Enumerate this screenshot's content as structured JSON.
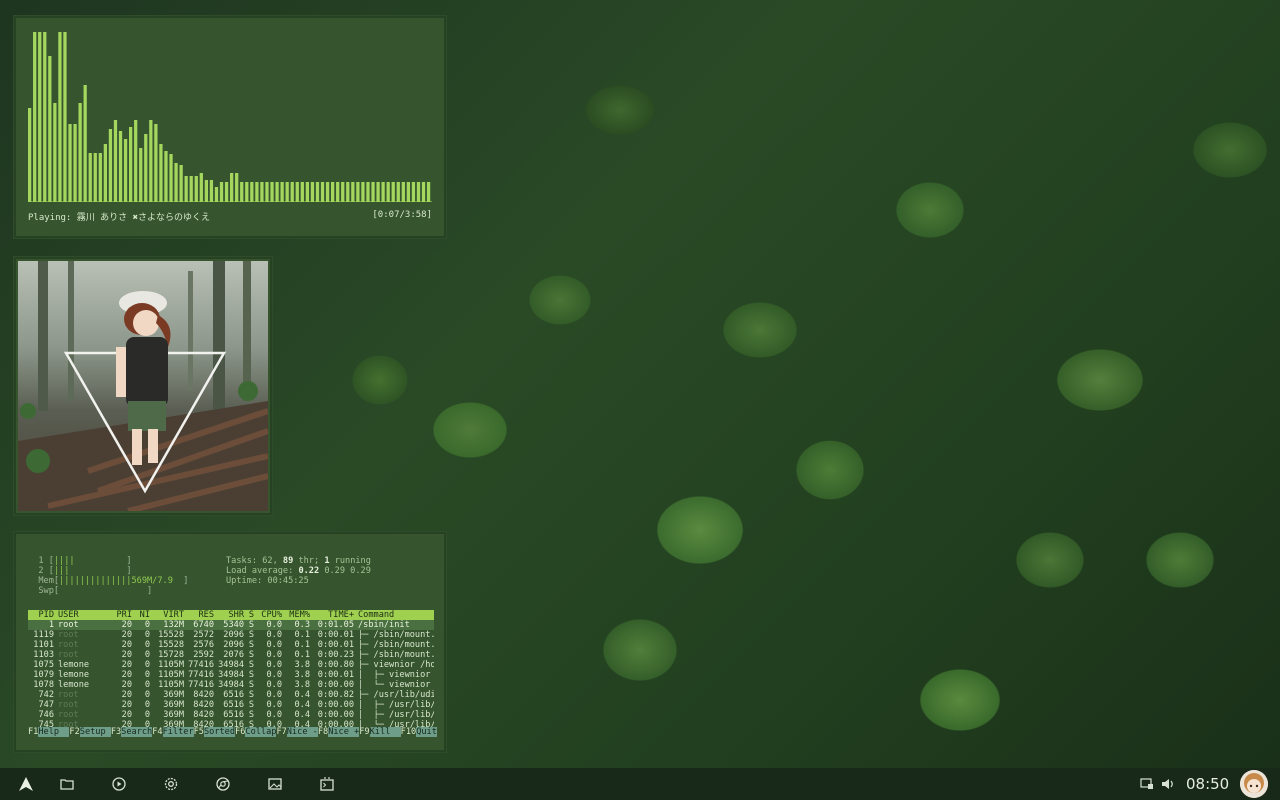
{
  "visualizer": {
    "now_playing": "Playing: 霧川 ありさ ✖さよならのゆくえ",
    "time": "[0:07/3:58]",
    "bar_color": "#a5d65e",
    "levels": [
      0.55,
      1.0,
      1.0,
      1.0,
      0.86,
      0.58,
      1.0,
      1.0,
      0.46,
      0.46,
      0.58,
      0.69,
      0.29,
      0.29,
      0.29,
      0.34,
      0.43,
      0.48,
      0.42,
      0.37,
      0.44,
      0.48,
      0.32,
      0.4,
      0.48,
      0.46,
      0.34,
      0.3,
      0.28,
      0.23,
      0.22,
      0.15,
      0.15,
      0.15,
      0.17,
      0.13,
      0.13,
      0.09,
      0.12,
      0.12,
      0.17,
      0.17,
      0.12,
      0.12,
      0.12,
      0.12,
      0.12,
      0.12,
      0.12,
      0.12,
      0.12,
      0.12,
      0.12,
      0.12,
      0.12,
      0.12,
      0.12,
      0.12,
      0.12,
      0.12,
      0.12,
      0.12,
      0.12,
      0.12,
      0.12,
      0.12,
      0.12,
      0.12,
      0.12,
      0.12,
      0.12,
      0.12,
      0.12,
      0.12,
      0.12,
      0.12,
      0.12,
      0.12,
      0.12,
      0.12
    ]
  },
  "htop": {
    "cpu1_label": "  1 [",
    "cpu1_bar": "||||",
    "cpu1_end": "          ]",
    "cpu2_label": "  2 [",
    "cpu2_bar": "|||",
    "cpu2_end": "           ]",
    "mem_label": "  Mem[",
    "mem_bar": "||||||||||||||569M/7.9",
    "mem_end": "  ]",
    "swp_label": "  Swp[",
    "swp_end": "                 ]",
    "tasks_line_a": "Tasks: 62, ",
    "tasks_threads": "89",
    "tasks_line_b": " thr; ",
    "tasks_running": "1",
    "tasks_line_c": " running",
    "load_label": "Load average: ",
    "load_1": "0.22",
    "load_rest": " 0.29 0.29",
    "uptime": "Uptime: 00:45:25",
    "columns": [
      "PID",
      "USER",
      "PRI",
      "NI",
      "VIRT",
      "RES",
      "SHR",
      "S",
      "CPU%",
      "MEM%",
      "TIME+",
      "Command"
    ],
    "rows": [
      {
        "pid": "1",
        "user": "root",
        "pri": "20",
        "ni": "0",
        "virt": "132M",
        "res": "6740",
        "shr": "5340",
        "s": "S",
        "cpu": "0.0",
        "mem": "0.3",
        "time": "0:01.05",
        "cmd": "/sbin/init"
      },
      {
        "pid": "1119",
        "user": "root",
        "pri": "20",
        "ni": "0",
        "virt": "15528",
        "res": "2572",
        "shr": "2096",
        "s": "S",
        "cpu": "0.0",
        "mem": "0.1",
        "time": "0:00.01",
        "cmd": "├─ /sbin/mount.ntf"
      },
      {
        "pid": "1101",
        "user": "root",
        "pri": "20",
        "ni": "0",
        "virt": "15528",
        "res": "2576",
        "shr": "2096",
        "s": "S",
        "cpu": "0.0",
        "mem": "0.1",
        "time": "0:00.01",
        "cmd": "├─ /sbin/mount.ntf"
      },
      {
        "pid": "1103",
        "user": "root",
        "pri": "20",
        "ni": "0",
        "virt": "15728",
        "res": "2592",
        "shr": "2076",
        "s": "S",
        "cpu": "0.0",
        "mem": "0.1",
        "time": "0:00.23",
        "cmd": "├─ /sbin/mount.ntf"
      },
      {
        "pid": "1075",
        "user": "lemone",
        "pri": "20",
        "ni": "0",
        "virt": "1105M",
        "res": "77416",
        "shr": "34984",
        "s": "S",
        "cpu": "0.0",
        "mem": "3.8",
        "time": "0:00.80",
        "cmd": "├─ viewnior /home/"
      },
      {
        "pid": "1079",
        "user": "lemone",
        "pri": "20",
        "ni": "0",
        "virt": "1105M",
        "res": "77416",
        "shr": "34984",
        "s": "S",
        "cpu": "0.0",
        "mem": "3.8",
        "time": "0:00.01",
        "cmd": "│  ├─ viewnior /ho"
      },
      {
        "pid": "1078",
        "user": "lemone",
        "pri": "20",
        "ni": "0",
        "virt": "1105M",
        "res": "77416",
        "shr": "34984",
        "s": "S",
        "cpu": "0.0",
        "mem": "3.8",
        "time": "0:00.00",
        "cmd": "│  └─ viewnior /ho"
      },
      {
        "pid": "742",
        "user": "root",
        "pri": "20",
        "ni": "0",
        "virt": "369M",
        "res": "8420",
        "shr": "6516",
        "s": "S",
        "cpu": "0.0",
        "mem": "0.4",
        "time": "0:00.82",
        "cmd": "├─ /usr/lib/udisks"
      },
      {
        "pid": "747",
        "user": "root",
        "pri": "20",
        "ni": "0",
        "virt": "369M",
        "res": "8420",
        "shr": "6516",
        "s": "S",
        "cpu": "0.0",
        "mem": "0.4",
        "time": "0:00.00",
        "cmd": "│  ├─ /usr/lib/udi"
      },
      {
        "pid": "746",
        "user": "root",
        "pri": "20",
        "ni": "0",
        "virt": "369M",
        "res": "8420",
        "shr": "6516",
        "s": "S",
        "cpu": "0.0",
        "mem": "0.4",
        "time": "0:00.00",
        "cmd": "│  ├─ /usr/lib/udi"
      },
      {
        "pid": "745",
        "user": "root",
        "pri": "20",
        "ni": "0",
        "virt": "369M",
        "res": "8420",
        "shr": "6516",
        "s": "S",
        "cpu": "0.0",
        "mem": "0.4",
        "time": "0:00.00",
        "cmd": "│  └─ /usr/lib/udi"
      }
    ],
    "fkeys": [
      {
        "key": "F1",
        "label": "Help  "
      },
      {
        "key": "F2",
        "label": "Setup "
      },
      {
        "key": "F3",
        "label": "Search"
      },
      {
        "key": "F4",
        "label": "Filter"
      },
      {
        "key": "F5",
        "label": "Sorted"
      },
      {
        "key": "F6",
        "label": "Collap"
      },
      {
        "key": "F7",
        "label": "Nice -"
      },
      {
        "key": "F8",
        "label": "Nice +"
      },
      {
        "key": "F9",
        "label": "Kill  "
      },
      {
        "key": "F10",
        "label": "Quit"
      }
    ]
  },
  "taskbar": {
    "time": "08:50",
    "launcher_icon": "arch-logo-icon",
    "apps": [
      "files-icon",
      "music-player-icon",
      "settings-icon",
      "browser-icon",
      "image-viewer-icon",
      "terminal-icon"
    ],
    "tray": [
      "display-icon",
      "volume-icon"
    ]
  }
}
